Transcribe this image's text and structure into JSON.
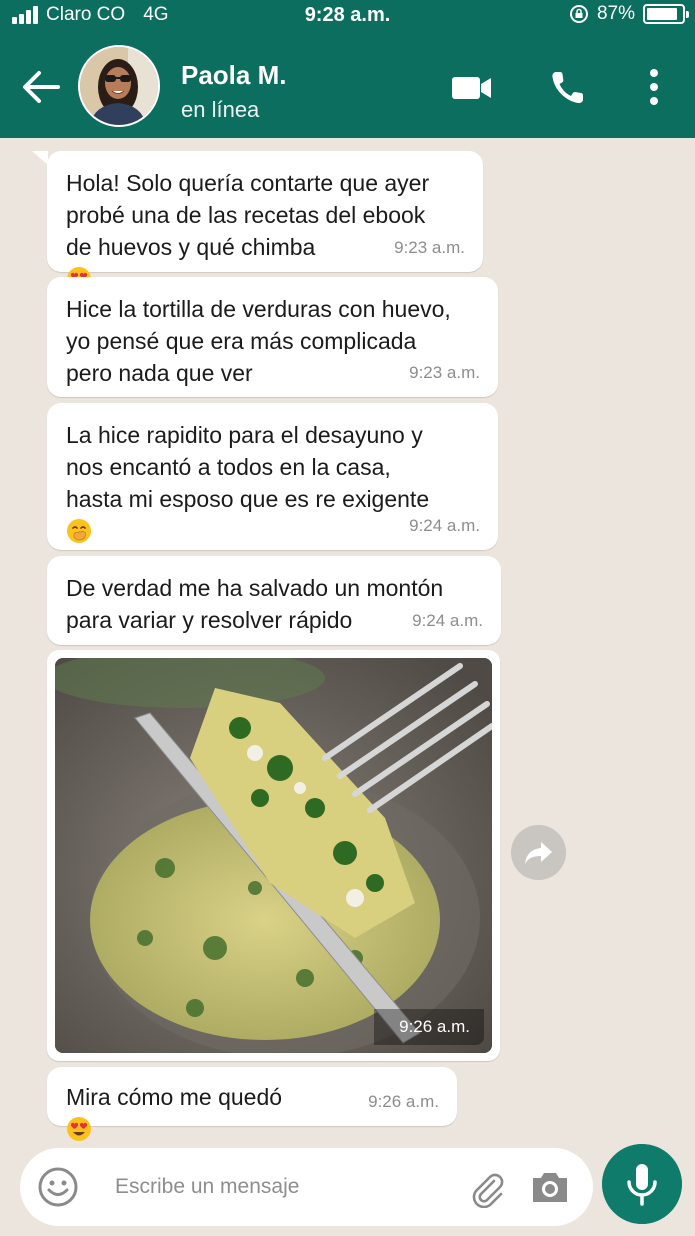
{
  "status_bar": {
    "carrier": "Claro CO",
    "network": "4G",
    "time": "9:28 a.m.",
    "battery": "87%",
    "battery_level": 0.87
  },
  "contact": {
    "name": "Paola M.",
    "status": "en línea"
  },
  "messages": [
    {
      "text": "Hola! Solo quería contarte que ayer\nprobé una de las recetas del ebook\nde huevos y qué chimba",
      "emoji": "heart-eyes",
      "time": "9:23 a.m."
    },
    {
      "text": "Hice la tortilla de verduras con huevo,\nyo pensé que era más complicada\npero nada que ver",
      "time": "9:23 a.m."
    },
    {
      "text": "La hice rapidito para el desayuno y\nnos encantó a todos en la casa,\nhasta mi esposo que es re exigente",
      "emoji": "hand-over-mouth",
      "time": "9:24 a.m."
    },
    {
      "text": "De verdad me ha salvado un montón\npara variar y resolver rápido",
      "time": "9:24 a.m."
    },
    {
      "type": "image",
      "time": "9:26 a.m."
    },
    {
      "text": "Mira cómo me quedó",
      "emoji": "heart-eyes",
      "time": "9:26 a.m."
    }
  ],
  "input": {
    "placeholder": "Escribe un mensaje"
  },
  "colors": {
    "header": "#0b6e5f",
    "chat_bg": "#ece5dd",
    "bubble": "#ffffff",
    "mic_button": "#0f7c6b"
  }
}
